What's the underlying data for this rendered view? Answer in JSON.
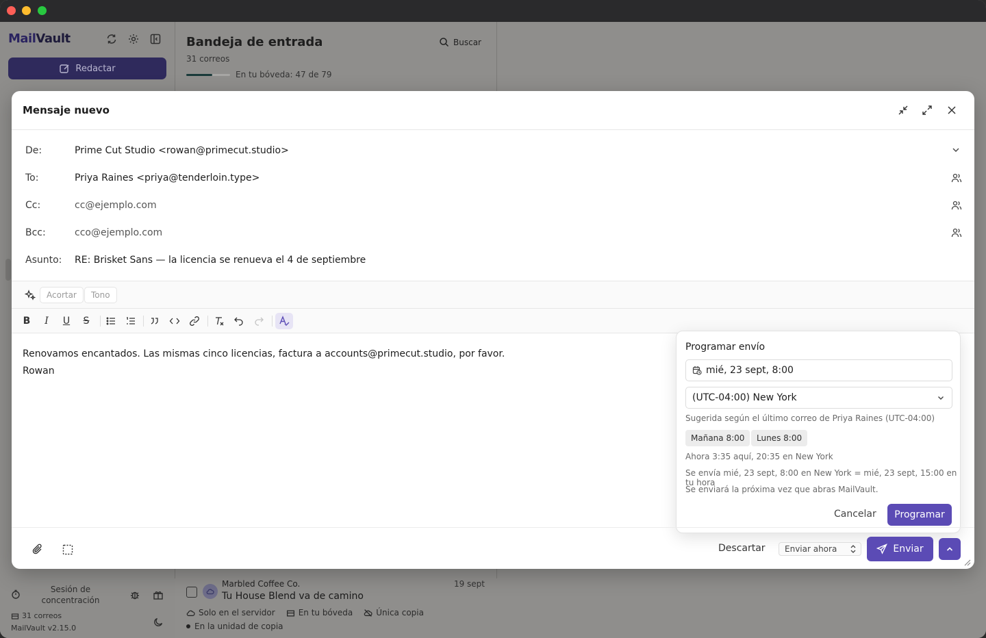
{
  "app": {
    "logo_mail": "Mail",
    "logo_vault": "Vault"
  },
  "sidebar": {
    "compose_label": "Redactar",
    "focus_label": "Sesión de concentración",
    "mail_count": "31 correos",
    "version": "MailVault v2.15.0"
  },
  "inbox": {
    "title": "Bandeja de entrada",
    "count": "31 correos",
    "vault_label": "En tu bóveda: 47 de 79",
    "vault_progress": 0.59,
    "search_label": "Buscar"
  },
  "mail_row": {
    "from": "Marbled Coffee Co.",
    "subject": "Tu House Blend va de camino",
    "date": "19 sept",
    "tag_server": "Solo en el servidor",
    "tag_vault": "En tu bóveda",
    "tag_single": "Única copia",
    "tag_backup": "En la unidad de copia"
  },
  "compose": {
    "title": "Mensaje nuevo",
    "from_label": "De:",
    "from_value": "Prime Cut Studio <rowan@primecut.studio>",
    "to_label": "To:",
    "to_value": "Priya Raines <priya@tenderloin.type>",
    "cc_label": "Cc:",
    "cc_placeholder": "cc@ejemplo.com",
    "bcc_label": "Bcc:",
    "bcc_placeholder": "cco@ejemplo.com",
    "subject_label": "Asunto:",
    "subject_value": "RE: Brisket Sans — la licencia se renueva el 4 de septiembre",
    "ai_shorten": "Acortar",
    "ai_tone": "Tono",
    "body_line1": "Renovamos encantados. Las mismas cinco licencias, factura a accounts@primecut.studio, por favor.",
    "body_line2": "Rowan",
    "discard": "Descartar",
    "send_mode": "Enviar ahora",
    "send": "Enviar"
  },
  "schedule": {
    "title": "Programar envío",
    "datetime": "mié, 23 sept, 8:00",
    "timezone": "(UTC-04:00) New York",
    "suggestion": "Sugerida según el último correo de Priya Raines (UTC-04:00)",
    "quick1": "Mañana 8:00",
    "quick2": "Lunes 8:00",
    "now": "Ahora 3:35 aquí, 20:35 en New York",
    "conversion": "Se envía mié, 23 sept, 8:00 en New York = mié, 23 sept, 15:00 en tu hora",
    "offline_note": "Se enviará la próxima vez que abras MailVault.",
    "cancel": "Cancelar",
    "confirm": "Programar"
  },
  "colors": {
    "accent": "#5b4bb5",
    "compose_dark": "#2f2a5c"
  }
}
